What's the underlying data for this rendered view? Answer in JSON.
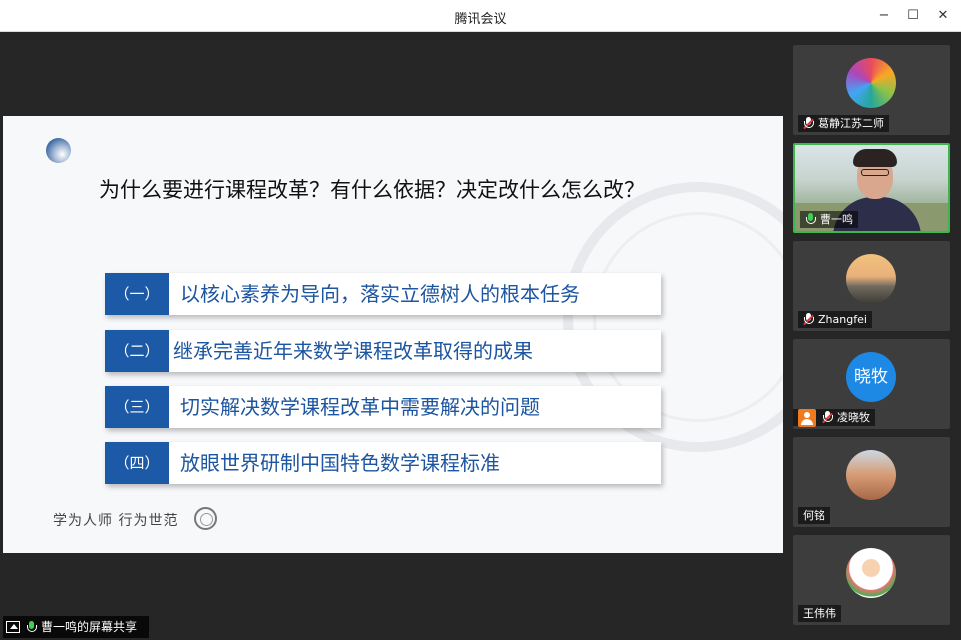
{
  "window": {
    "title": "腾讯会议"
  },
  "controls": {
    "minimize": "−",
    "maximize": "☐",
    "close": "✕"
  },
  "slide": {
    "question": "为什么要进行课程改革？有什么依据？决定改什么怎么改？",
    "items": [
      {
        "num": "（一）",
        "text": "以核心素养为导向，落实立德树人的根本任务"
      },
      {
        "num": "（二）",
        "text": "继承完善近年来数学课程改革取得的成果"
      },
      {
        "num": "（三）",
        "text": "切实解决数学课程改革中需要解决的问题"
      },
      {
        "num": "（四）",
        "text": "放眼世界研制中国特色数学课程标准"
      }
    ],
    "motto": "学为人师 行为世范"
  },
  "participants": [
    {
      "name": "葛静江苏二师",
      "mic": "muted"
    },
    {
      "name": "曹一鸣",
      "mic": "on",
      "active": true
    },
    {
      "name": "Zhangfei",
      "mic": "muted"
    },
    {
      "name": "凌晓牧",
      "mic": "muted",
      "avatar_text": "晓牧"
    },
    {
      "name": "何铭",
      "mic": "none"
    },
    {
      "name": "王伟伟",
      "mic": "none"
    }
  ],
  "share": {
    "label": "曹一鸣的屏幕共享"
  },
  "colors": {
    "accent": "#1c5aa7",
    "active_border": "#3fb64d",
    "muted": "#e23a3a"
  }
}
